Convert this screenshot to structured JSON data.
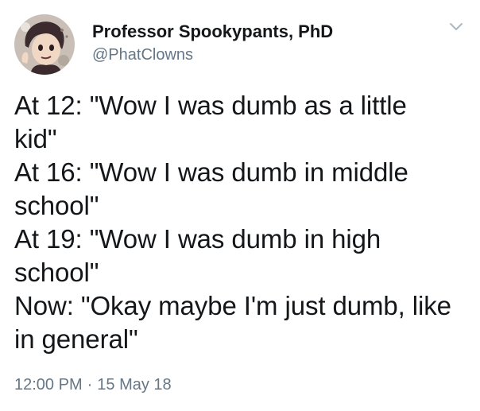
{
  "author": {
    "display_name": "Professor Spookypants, PhD",
    "handle": "@PhatClowns",
    "avatar_icon": "cartoon-face-avatar"
  },
  "tweet": {
    "lines": [
      "At 12: \"Wow I was dumb as a little",
      "kid\"",
      "At 16: \"Wow I was dumb in middle",
      "school\"",
      "At 19: \"Wow I was dumb in high",
      "school\"",
      "Now: \"Okay maybe I'm just dumb, like",
      "in general\""
    ],
    "time": "12:00 PM",
    "separator": "·",
    "date": "15 May 18"
  },
  "colors": {
    "text": "#14171a",
    "secondary": "#657786"
  }
}
